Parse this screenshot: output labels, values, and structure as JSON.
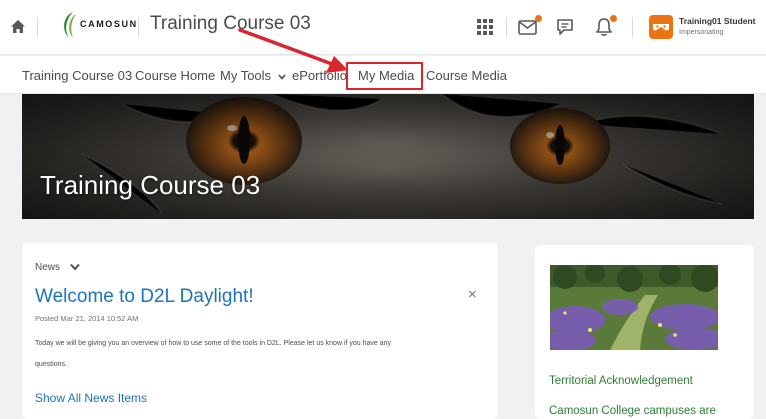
{
  "header": {
    "logo_text": "CAMOSUN",
    "course_title": "Training Course 03",
    "user_name": "Training01 Student",
    "user_status": "Impersonating",
    "icons": [
      "home-icon",
      "waffle-icon",
      "mail-icon",
      "chat-icon",
      "bell-icon"
    ],
    "accent_color": "#e87511"
  },
  "navbar": {
    "items": [
      "Training Course 03",
      "Course Home",
      "My Tools",
      "ePortfolio",
      "My Media",
      "Course Media"
    ],
    "highlighted_item": "My Media",
    "highlight_color": "#d9252c"
  },
  "banner": {
    "title": "Training Course 03"
  },
  "news": {
    "header": "News",
    "title": "Welcome to D2L Daylight!",
    "posted": "Posted Mar 21, 2014 10:52 AM",
    "body_line1": "Today we will be giving you an overview of how to use some of the tools in D2L.  Please let us know if you have any",
    "body_line2": "questions.",
    "show_all": "Show All News Items",
    "close_glyph": "×",
    "link_color": "#1e73be"
  },
  "side": {
    "title": "Territorial Acknowledgement",
    "text": "Camosun College campuses are",
    "text_color": "#2e7d32"
  }
}
